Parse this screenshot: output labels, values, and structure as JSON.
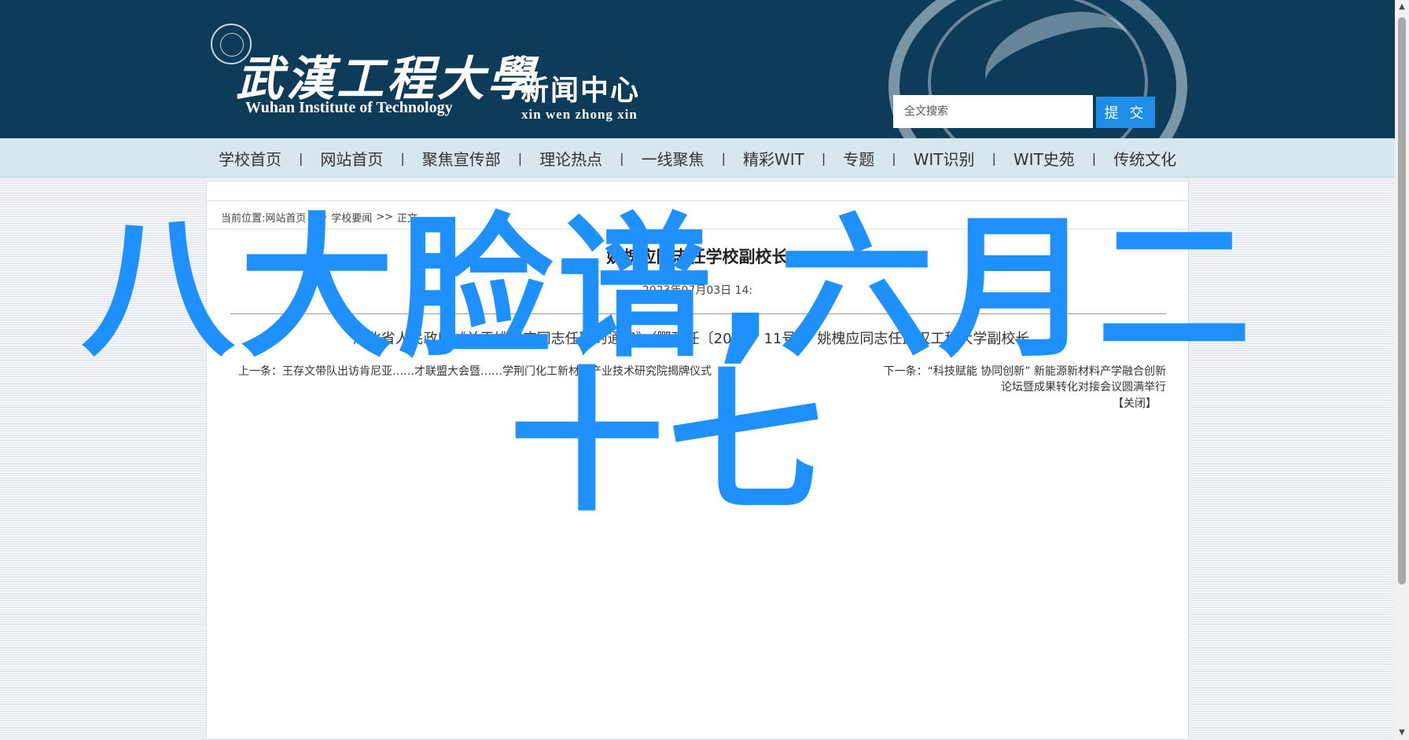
{
  "header": {
    "school_name_cn": "武漢工程大學",
    "school_name_en": "Wuhan Institute of Technology",
    "center_name_cn": "新闻中心",
    "center_name_en": "xin wen zhong xin",
    "search": {
      "placeholder": "全文搜索",
      "button_label": "提 交"
    }
  },
  "nav": {
    "items": [
      {
        "label": "学校首页"
      },
      {
        "label": "网站首页"
      },
      {
        "label": "聚焦宣传部"
      },
      {
        "label": "理论热点"
      },
      {
        "label": "一线聚焦"
      },
      {
        "label": "精彩WIT"
      },
      {
        "label": "专题"
      },
      {
        "label": "WIT识别"
      },
      {
        "label": "WIT史苑"
      },
      {
        "label": "传统文化"
      }
    ],
    "separator": "|"
  },
  "breadcrumb": {
    "prefix": "当前位置:",
    "items": [
      "网站首页",
      "学校要闻",
      "正文"
    ],
    "separator": ">>"
  },
  "article": {
    "title": "姚槐应同志任学校副校长",
    "meta": "2023年07月03日 14:",
    "body": "湖北省人民政府《关于姚槐应同志任职的通知》（鄂政任〔2023〕11号），姚槐应同志任武汉工程大学副校长。",
    "prev": "上一条：王存文带队出访肯尼亚……才联盟大会暨……学荆门化工新材料产业技术研究院揭牌仪式",
    "next_prefix": "下一条：",
    "next": "“科技赋能 协同创新” 新能源新材料产学融合创新论坛暨成果转化对接会议圆满举行",
    "close": "【关闭】"
  },
  "overlay_text": "八大脸谱,六月二十七"
}
